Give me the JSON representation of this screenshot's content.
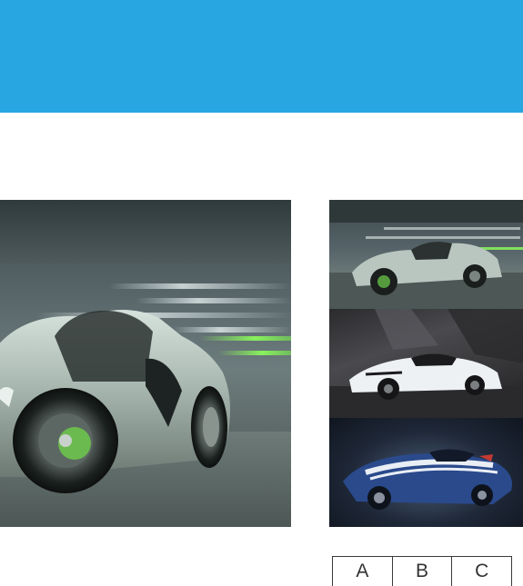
{
  "header": {
    "color": "#27a6e1"
  },
  "gallery": {
    "main_image": "silver-porsche-918-spyder-in-garage",
    "thumbnails": [
      {
        "image": "silver-porsche-918-spyder"
      },
      {
        "image": "white-lamborghini-huracan"
      },
      {
        "image": "blue-ferrari-f60-america"
      }
    ],
    "pager": {
      "buttons": [
        "A",
        "B",
        "C"
      ]
    }
  }
}
